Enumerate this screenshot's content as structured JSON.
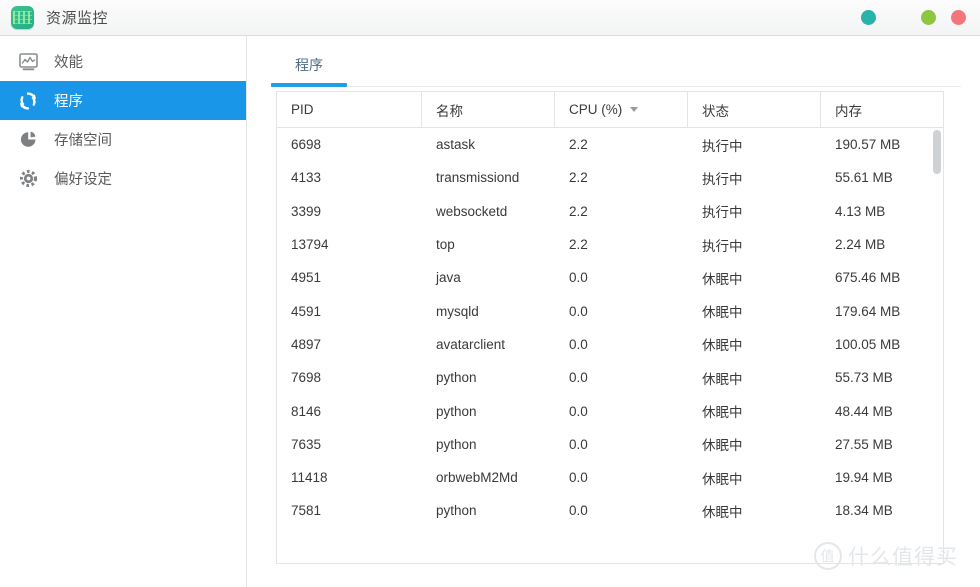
{
  "window": {
    "title": "资源监控",
    "app_icon": "resource-monitor-icon",
    "controls": [
      {
        "name": "teal-dot",
        "color": "#27b3ac"
      },
      {
        "name": "yellow-dot",
        "color": "#f5c council"
      },
      {
        "name": "green-dot",
        "color": "#8dc63f"
      },
      {
        "name": "red-dot",
        "color": "#f4767a"
      }
    ]
  },
  "sidebar": {
    "items": [
      {
        "label": "效能",
        "icon": "performance-chart-icon",
        "active": false
      },
      {
        "label": "程序",
        "icon": "processes-sync-icon",
        "active": true
      },
      {
        "label": "存储空间",
        "icon": "storage-pie-icon",
        "active": false
      },
      {
        "label": "偏好设定",
        "icon": "preferences-gear-icon",
        "active": false
      }
    ]
  },
  "main": {
    "tabs": [
      {
        "label": "程序",
        "active": true
      }
    ],
    "table": {
      "columns": [
        {
          "key": "pid",
          "label": "PID",
          "sorted": false
        },
        {
          "key": "name",
          "label": "名称",
          "sorted": false
        },
        {
          "key": "cpu",
          "label": "CPU (%)",
          "sorted": true,
          "sort_direction": "desc"
        },
        {
          "key": "status",
          "label": "状态",
          "sorted": false
        },
        {
          "key": "memory",
          "label": "内存",
          "sorted": false
        }
      ],
      "rows": [
        {
          "pid": "6698",
          "name": "astask",
          "cpu": "2.2",
          "status": "执行中",
          "memory": "190.57 MB"
        },
        {
          "pid": "4133",
          "name": "transmissiond",
          "cpu": "2.2",
          "status": "执行中",
          "memory": "55.61 MB"
        },
        {
          "pid": "3399",
          "name": "websocketd",
          "cpu": "2.2",
          "status": "执行中",
          "memory": "4.13 MB"
        },
        {
          "pid": "13794",
          "name": "top",
          "cpu": "2.2",
          "status": "执行中",
          "memory": "2.24 MB"
        },
        {
          "pid": "4951",
          "name": "java",
          "cpu": "0.0",
          "status": "休眠中",
          "memory": "675.46 MB"
        },
        {
          "pid": "4591",
          "name": "mysqld",
          "cpu": "0.0",
          "status": "休眠中",
          "memory": "179.64 MB"
        },
        {
          "pid": "4897",
          "name": "avatarclient",
          "cpu": "0.0",
          "status": "休眠中",
          "memory": "100.05 MB"
        },
        {
          "pid": "7698",
          "name": "python",
          "cpu": "0.0",
          "status": "休眠中",
          "memory": "55.73 MB"
        },
        {
          "pid": "8146",
          "name": "python",
          "cpu": "0.0",
          "status": "休眠中",
          "memory": "48.44 MB"
        },
        {
          "pid": "7635",
          "name": "python",
          "cpu": "0.0",
          "status": "休眠中",
          "memory": "27.55 MB"
        },
        {
          "pid": "11418",
          "name": "orbwebM2Md",
          "cpu": "0.0",
          "status": "休眠中",
          "memory": "19.94 MB"
        },
        {
          "pid": "7581",
          "name": "python",
          "cpu": "0.0",
          "status": "休眠中",
          "memory": "18.34 MB"
        }
      ]
    }
  },
  "watermark": {
    "badge": "值",
    "text": "什么值得买"
  },
  "colors": {
    "accent": "#1a96e8",
    "tab_underline": "#1f9fe8",
    "app_icon": "#2cb68a",
    "border": "#e2e4e6"
  }
}
